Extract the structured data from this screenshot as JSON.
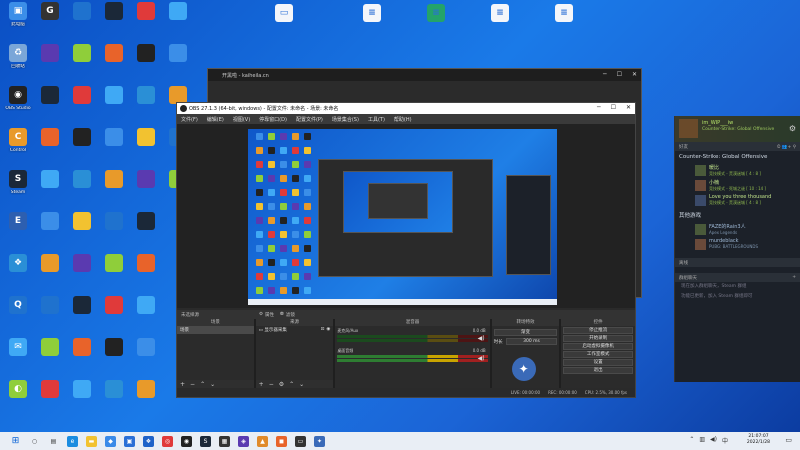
{
  "desktop": {
    "icons": [
      {
        "label": "此电脑",
        "color": "#3b8ee8",
        "glyph": "▣"
      },
      {
        "label": "回收站",
        "color": "#7aa6d8",
        "glyph": "♻"
      },
      {
        "label": "OBS Studio",
        "color": "#222222",
        "glyph": "◉"
      },
      {
        "label": "Control",
        "color": "#e89a2a",
        "glyph": "C"
      },
      {
        "label": "Steam",
        "color": "#1b2838",
        "glyph": "S"
      },
      {
        "label": "",
        "color": "#2d5fb0",
        "glyph": "E"
      },
      {
        "label": "",
        "color": "#2a8fd6",
        "glyph": "❖"
      },
      {
        "label": "",
        "color": "#1f72ce",
        "glyph": "Q"
      },
      {
        "label": "",
        "color": "#3fa9f5",
        "glyph": "✉"
      },
      {
        "label": "",
        "color": "#8fce3a",
        "glyph": "◐"
      },
      {
        "label": "",
        "color": "#333333",
        "glyph": "G"
      }
    ]
  },
  "back_window": {
    "title": "开黑啦 - kaiheila.cn"
  },
  "obs": {
    "title": "OBS 27.1.3 (64-bit, windows) - 配置文件: 未命名 - 场景: 未命名",
    "menu": [
      "文件(F)",
      "编辑(E)",
      "视图(V)",
      "停靠窗口(D)",
      "配置文件(P)",
      "场景集合(S)",
      "工具(T)",
      "帮助(H)"
    ],
    "scene_bar": {
      "label": "未选择源",
      "props": "属性",
      "filters": "滤镜"
    },
    "docks": {
      "scenes": {
        "title": "场景",
        "items": [
          "场景"
        ]
      },
      "sources": {
        "title": "来源",
        "items": [
          "显示器采集"
        ]
      },
      "mixer": {
        "title": "混音器",
        "channels": [
          {
            "name": "麦克风/Aux",
            "value": "0.0 dB"
          },
          {
            "name": "桌面音频",
            "value": "0.0 dB"
          }
        ]
      },
      "transitions": {
        "title": "转场特效",
        "type": "渐变",
        "duration_label": "时长",
        "duration": "300 ms"
      },
      "controls": {
        "title": "控件",
        "buttons": [
          "停止推流",
          "开始录制",
          "启动虚拟摄像机",
          "工作室模式",
          "设置",
          "退出"
        ]
      }
    },
    "status": {
      "live": "LIVE: 00:00:00",
      "rec": "REC: 00:00:00",
      "cpu": "CPU: 2.5%, 30.00 fps"
    }
  },
  "steam": {
    "profile": {
      "name": "im_WIP___iw",
      "game": "Counter-Strike: Global Offensive"
    },
    "section": "好友",
    "group_title": "Counter-Strike: Global Offensive",
    "friends": [
      {
        "name": "暖比",
        "status": "竞技模式 - 荒漠迷城 [ 4 : 8 ]"
      },
      {
        "name": "小楠",
        "status": "竞技模式 - 死城之谜 [ 10 : 14 ]"
      },
      {
        "name": "Love you three thousand",
        "status": "竞技模式 - 荒漠迷城 [ 4 : 8 ]"
      }
    ],
    "other_title": "其他游戏",
    "others": [
      {
        "name": "FAZE的Rain3人",
        "status": "Apex Legends"
      },
      {
        "name": "murdeblack",
        "status": "PUBG: BATTLEGROUNDS"
      }
    ],
    "offline_label": "离线",
    "chat_title": "群组聊天",
    "chat_msgs": [
      "现在加入群组聊天，Steam 群组",
      "功能已更新，加入 Steam 群组即可"
    ]
  },
  "taskbar": {
    "time": "21:07:07",
    "date": "2022/1/28"
  }
}
